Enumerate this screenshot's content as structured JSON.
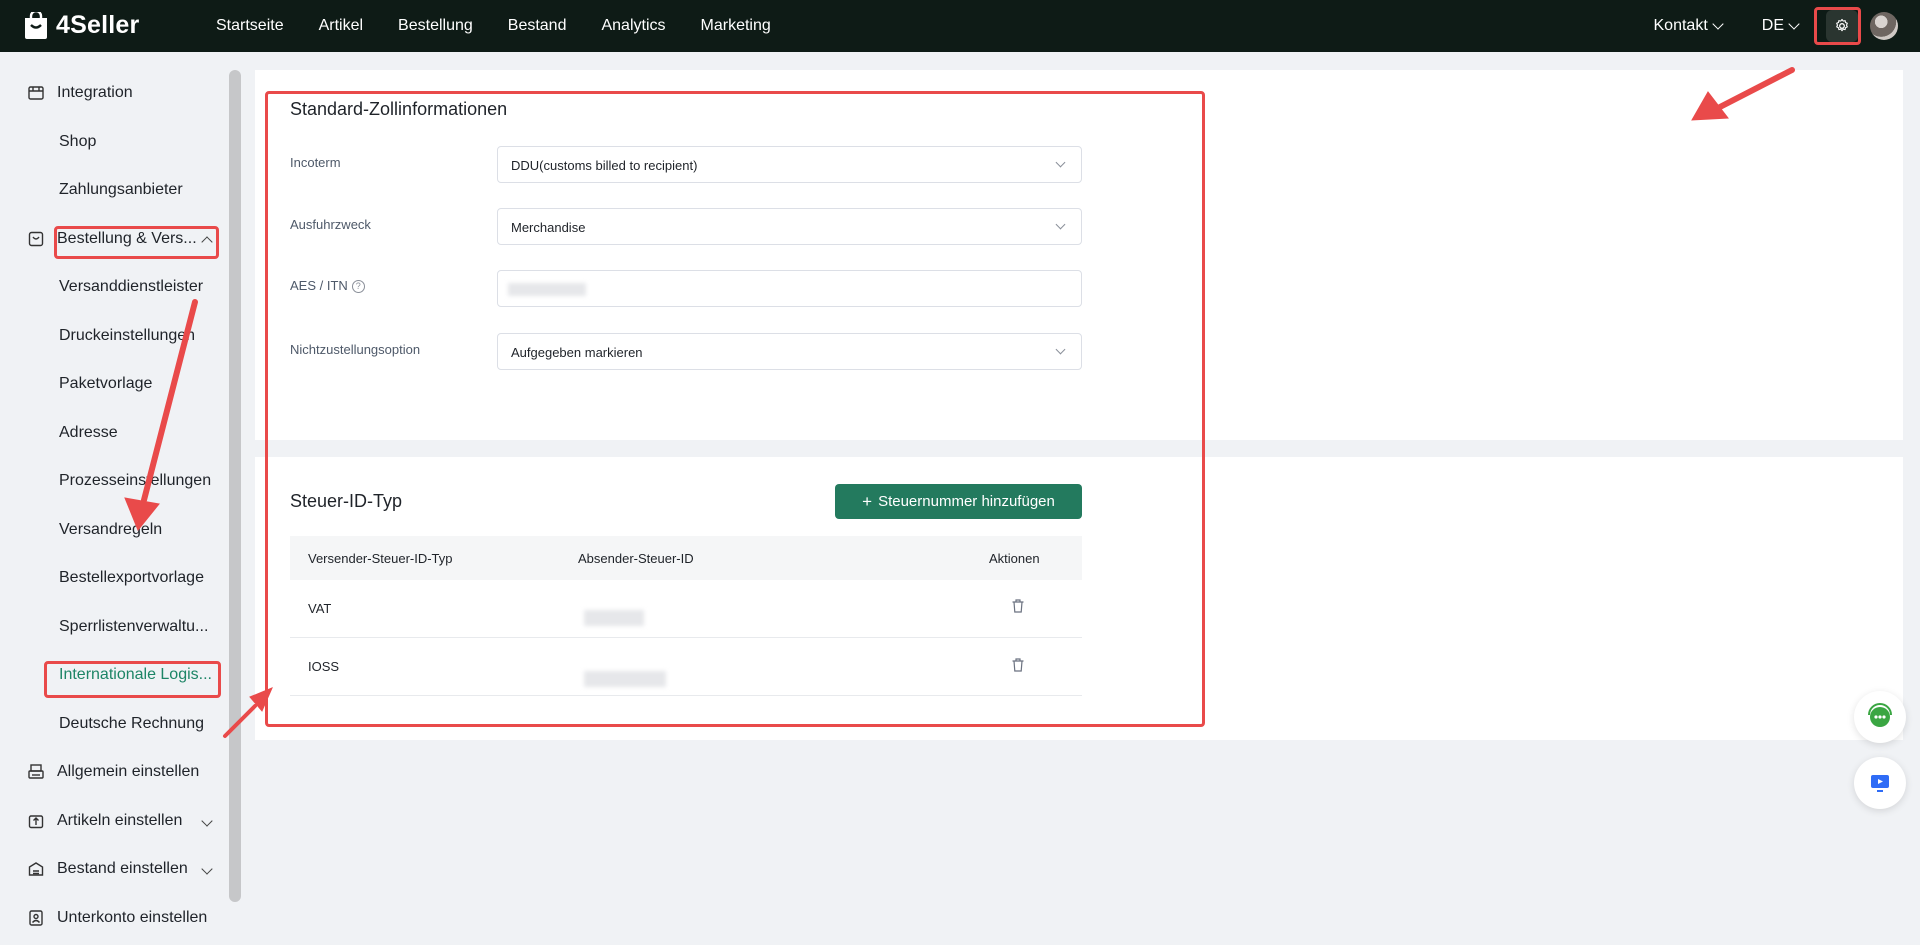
{
  "app": {
    "name": "4Seller"
  },
  "header": {
    "nav": [
      "Startseite",
      "Artikel",
      "Bestellung",
      "Bestand",
      "Analytics",
      "Marketing"
    ],
    "contact": "Kontakt",
    "language": "DE"
  },
  "sidebar": {
    "items": [
      {
        "label": "Integration",
        "icon": "store-icon",
        "level": 0
      },
      {
        "label": "Shop",
        "level": 1
      },
      {
        "label": "Zahlungsanbieter",
        "level": 1
      },
      {
        "label": "Bestellung & Versand",
        "display": "Bestellung & Vers...",
        "icon": "order-icon",
        "level": 0,
        "expanded": true
      },
      {
        "label": "Versanddienstleister",
        "level": 1
      },
      {
        "label": "Druckeinstellungen",
        "level": 1
      },
      {
        "label": "Paketvorlage",
        "level": 1
      },
      {
        "label": "Adresse",
        "level": 1
      },
      {
        "label": "Prozesseinstellungen",
        "level": 1
      },
      {
        "label": "Versandregeln",
        "level": 1
      },
      {
        "label": "Bestellexportvorlage",
        "level": 1
      },
      {
        "label": "Sperrlistenverwaltu...",
        "level": 1
      },
      {
        "label": "Internationale Logis...",
        "level": 1,
        "active": true
      },
      {
        "label": "Deutsche Rechnung",
        "level": 1
      },
      {
        "label": "Allgemein einstellen",
        "icon": "printer-icon",
        "level": 0
      },
      {
        "label": "Artikeln einstellen",
        "icon": "upload-box-icon",
        "level": 0,
        "expandable": true
      },
      {
        "label": "Bestand einstellen",
        "icon": "inventory-icon",
        "level": 0,
        "expandable": true
      },
      {
        "label": "Unterkonto einstellen",
        "icon": "user-badge-icon",
        "level": 0
      }
    ]
  },
  "customs": {
    "title": "Standard-Zollinformationen",
    "incoterm_label": "Incoterm",
    "incoterm_value": "DDU(customs billed to recipient)",
    "purpose_label": "Ausfuhrzweck",
    "purpose_value": "Merchandise",
    "aes_label": "AES / ITN",
    "nondelivery_label": "Nichtzustellungsoption",
    "nondelivery_value": "Aufgegeben markieren"
  },
  "tax": {
    "title": "Steuer-ID-Typ",
    "add_button": "Steuernummer hinzufügen",
    "columns": [
      "Versender-Steuer-ID-Typ",
      "Absender-Steuer-ID",
      "Aktionen"
    ],
    "rows": [
      {
        "type": "VAT"
      },
      {
        "type": "IOSS"
      }
    ]
  },
  "colors": {
    "brand": "#237a5e",
    "topbar": "#0e1b16",
    "annotation": "#e94a4a",
    "active": "#1d8566"
  }
}
